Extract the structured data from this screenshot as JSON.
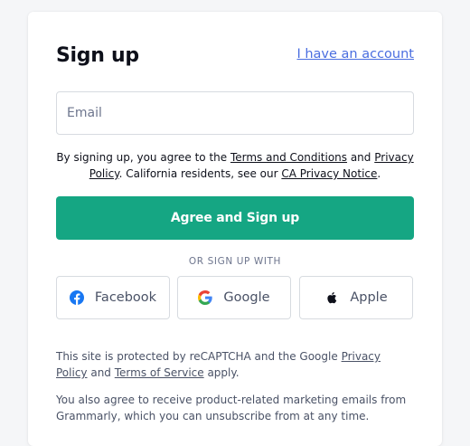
{
  "signup": {
    "title": "Sign up",
    "have_account_link": "I have an account",
    "email_placeholder": "Email",
    "terms": {
      "prefix": "By signing up, you agree to the ",
      "terms_link": "Terms and Conditions",
      "and": " and ",
      "privacy_link": "Privacy Policy",
      "middle": ". California residents, see our ",
      "ca_link": "CA Privacy Notice",
      "suffix": "."
    },
    "primary_button": "Agree and Sign up",
    "divider": "OR SIGN UP WITH",
    "social": [
      {
        "label": "Facebook",
        "icon": "facebook-icon"
      },
      {
        "label": "Google",
        "icon": "google-icon"
      },
      {
        "label": "Apple",
        "icon": "apple-icon"
      }
    ],
    "recaptcha": {
      "prefix": "This site is protected by reCAPTCHA and the Google ",
      "privacy_link": "Privacy Policy",
      "middle": " and ",
      "tos_link": "Terms of Service",
      "suffix": " apply."
    },
    "marketing_note": "You also agree to receive product-related marketing emails from Grammarly, which you can unsubscribe from at any time."
  },
  "colors": {
    "primary": "#15a683",
    "link": "#4a6ee0",
    "facebook": "#1877f2"
  }
}
